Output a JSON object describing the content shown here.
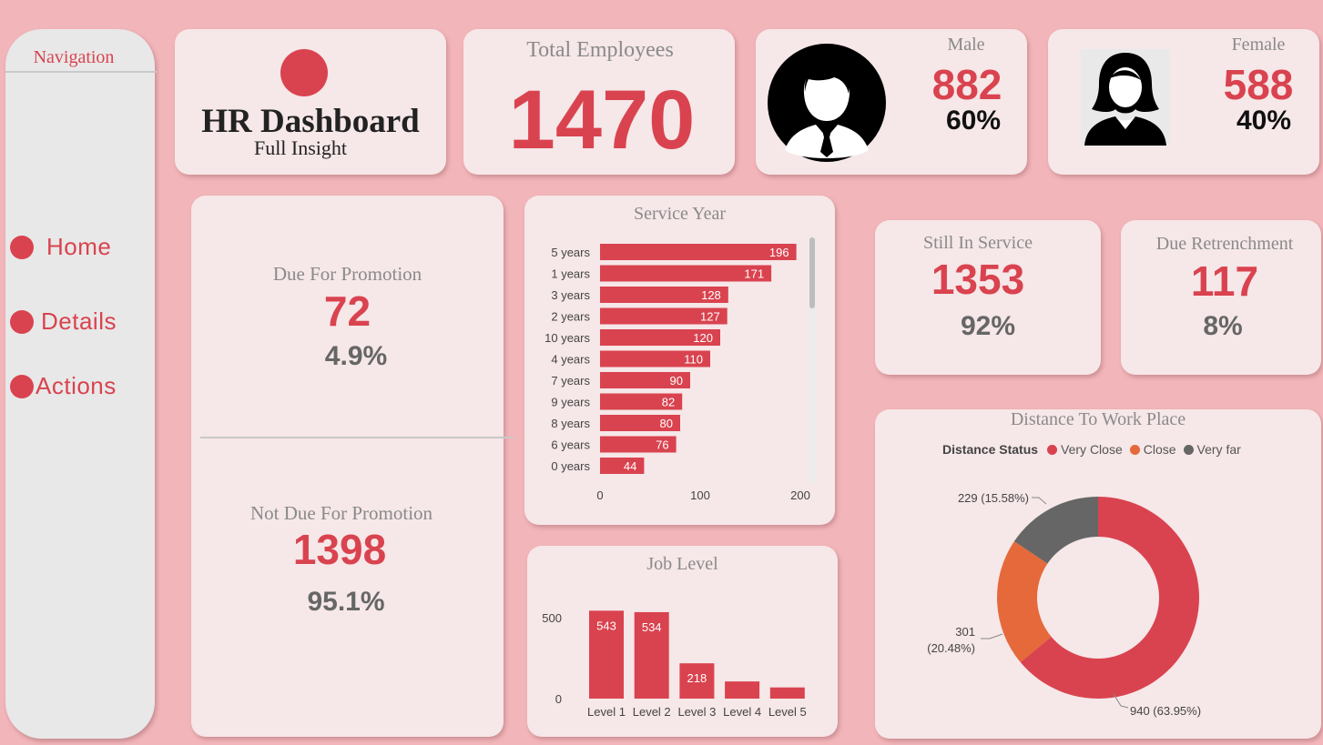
{
  "nav": {
    "title": "Navigation",
    "items": [
      {
        "label": "Home"
      },
      {
        "label": "Details"
      },
      {
        "label": "Actions"
      }
    ]
  },
  "header": {
    "title": "HR Dashboard",
    "subtitle": "Full Insight"
  },
  "total": {
    "label": "Total Employees",
    "value": "1470"
  },
  "male": {
    "label": "Male",
    "value": "882",
    "pct": "60%"
  },
  "female": {
    "label": "Female",
    "value": "588",
    "pct": "40%"
  },
  "promotion": {
    "due_label": "Due For Promotion",
    "due_value": "72",
    "due_pct": "4.9%",
    "not_label": "Not Due For Promotion",
    "not_value": "1398",
    "not_pct": "95.1%"
  },
  "service": {
    "label": "Still In Service",
    "value": "1353",
    "pct": "92%"
  },
  "retrench": {
    "label": "Due Retrenchment",
    "value": "117",
    "pct": "8%"
  },
  "colors": {
    "accent": "#d9434f",
    "orange": "#e5693a",
    "dark_grey": "#666666",
    "card": "#f6e7e8",
    "background": "#f2b5b9"
  },
  "chart_data": [
    {
      "type": "bar",
      "orientation": "horizontal",
      "title": "Service Year",
      "categories": [
        "5 years",
        "1 years",
        "3 years",
        "2 years",
        "10 years",
        "4 years",
        "7 years",
        "9 years",
        "8 years",
        "6 years",
        "0 years"
      ],
      "values": [
        196,
        171,
        128,
        127,
        120,
        110,
        90,
        82,
        80,
        76,
        44
      ],
      "xticks": [
        0,
        100,
        200
      ],
      "xlim": [
        0,
        200
      ]
    },
    {
      "type": "bar",
      "title": "Job Level",
      "categories": [
        "Level 1",
        "Level 2",
        "Level 3",
        "Level 4",
        "Level 5"
      ],
      "values": [
        543,
        534,
        218,
        106,
        69
      ],
      "value_labels": [
        "543",
        "534",
        "218",
        "",
        ""
      ],
      "yticks": [
        0,
        500
      ],
      "ylim": [
        0,
        600
      ]
    },
    {
      "type": "pie",
      "donut": true,
      "title": "Distance To Work Place",
      "legend_title": "Distance Status",
      "legend_position": "top",
      "series": [
        {
          "name": "Very Close",
          "value": 940,
          "label": "940 (63.95%)",
          "color": "#d9434f"
        },
        {
          "name": "Close",
          "value": 301,
          "label": "301 (20.48%)",
          "color": "#e5693a"
        },
        {
          "name": "Very far",
          "value": 229,
          "label": "229 (15.58%)",
          "color": "#666666"
        }
      ]
    }
  ]
}
